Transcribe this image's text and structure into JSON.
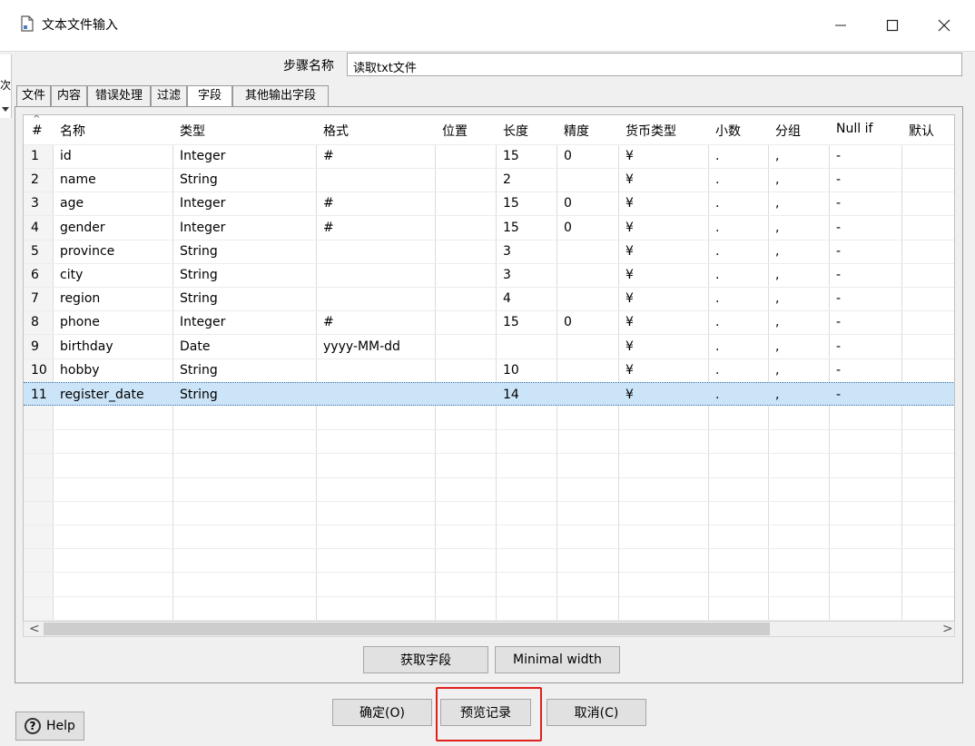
{
  "window": {
    "title": "文本文件输入",
    "minimize_icon": "minimize-icon",
    "maximize_icon": "maximize-icon",
    "close_icon": "close-icon"
  },
  "edge": {
    "text": "次"
  },
  "step": {
    "label": "步骤名称",
    "value": "读取txt文件"
  },
  "tabs": [
    {
      "label": "文件"
    },
    {
      "label": "内容"
    },
    {
      "label": "错误处理"
    },
    {
      "label": "过滤"
    },
    {
      "label": "字段",
      "active": true
    },
    {
      "label": "其他输出字段"
    }
  ],
  "grid": {
    "sort_indicator": "^",
    "columns": [
      "#",
      "名称",
      "类型",
      "格式",
      "位置",
      "长度",
      "精度",
      "货币类型",
      "小数",
      "分组",
      "Null if",
      "默认"
    ],
    "rows": [
      {
        "n": "1",
        "name": "id",
        "type": "Integer",
        "format": "#",
        "position": "",
        "length": "15",
        "precision": "0",
        "currency": "¥",
        "decimal": ".",
        "group": ",",
        "nullif": "-"
      },
      {
        "n": "2",
        "name": "name",
        "type": "String",
        "format": "",
        "position": "",
        "length": "2",
        "precision": "",
        "currency": "¥",
        "decimal": ".",
        "group": ",",
        "nullif": "-"
      },
      {
        "n": "3",
        "name": "age",
        "type": "Integer",
        "format": "#",
        "position": "",
        "length": "15",
        "precision": "0",
        "currency": "¥",
        "decimal": ".",
        "group": ",",
        "nullif": "-"
      },
      {
        "n": "4",
        "name": "gender",
        "type": "Integer",
        "format": "#",
        "position": "",
        "length": "15",
        "precision": "0",
        "currency": "¥",
        "decimal": ".",
        "group": ",",
        "nullif": "-"
      },
      {
        "n": "5",
        "name": "province",
        "type": "String",
        "format": "",
        "position": "",
        "length": "3",
        "precision": "",
        "currency": "¥",
        "decimal": ".",
        "group": ",",
        "nullif": "-"
      },
      {
        "n": "6",
        "name": "city",
        "type": "String",
        "format": "",
        "position": "",
        "length": "3",
        "precision": "",
        "currency": "¥",
        "decimal": ".",
        "group": ",",
        "nullif": "-"
      },
      {
        "n": "7",
        "name": "region",
        "type": "String",
        "format": "",
        "position": "",
        "length": "4",
        "precision": "",
        "currency": "¥",
        "decimal": ".",
        "group": ",",
        "nullif": "-"
      },
      {
        "n": "8",
        "name": "phone",
        "type": "Integer",
        "format": "#",
        "position": "",
        "length": "15",
        "precision": "0",
        "currency": "¥",
        "decimal": ".",
        "group": ",",
        "nullif": "-"
      },
      {
        "n": "9",
        "name": "birthday",
        "type": "Date",
        "format": "yyyy-MM-dd",
        "position": "",
        "length": "",
        "precision": "",
        "currency": "¥",
        "decimal": ".",
        "group": ",",
        "nullif": "-"
      },
      {
        "n": "10",
        "name": "hobby",
        "type": "String",
        "format": "",
        "position": "",
        "length": "10",
        "precision": "",
        "currency": "¥",
        "decimal": ".",
        "group": ",",
        "nullif": "-"
      },
      {
        "n": "11",
        "name": "register_date",
        "type": "String",
        "format": "",
        "position": "",
        "length": "14",
        "precision": "",
        "currency": "¥",
        "decimal": ".",
        "group": ",",
        "nullif": "-",
        "selected": true
      }
    ]
  },
  "scroll": {
    "left_arrow": "<",
    "right_arrow": ">"
  },
  "buttons": {
    "get_fields": "获取字段",
    "minimal_width": "Minimal width",
    "ok": "确定(O)",
    "preview": "预览记录",
    "cancel": "取消(C)",
    "help": "Help",
    "help_icon_glyph": "?"
  },
  "colors": {
    "selected_row": "#cce4f7",
    "highlight_box": "#e0201c"
  }
}
